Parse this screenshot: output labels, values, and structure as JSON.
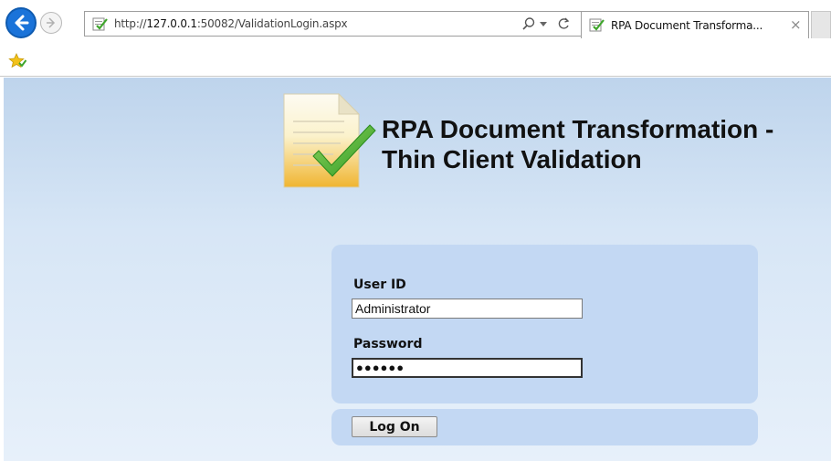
{
  "browser": {
    "url_prefix": "http://",
    "url_host": "127.0.0.1",
    "url_rest": ":50082/ValidationLogin.aspx",
    "tab_title": "RPA Document Transforma...",
    "tab_close": "×",
    "colors": {
      "back_button": "#1a73d9",
      "favorites_star": "#f2c21b"
    }
  },
  "app": {
    "title_line1": "RPA Document Transformation -",
    "title_line2": "Thin Client Validation",
    "logo_icon": "document-checkmark-icon"
  },
  "login": {
    "user_label": "User ID",
    "user_value": "Administrator",
    "password_label": "Password",
    "password_mask": "●●●●●●",
    "logon_label": "Log On"
  },
  "colors": {
    "page_gradient_top": "#bed4ec",
    "panel_background": "#c3d8f3",
    "check_green": "#4caf2e"
  }
}
